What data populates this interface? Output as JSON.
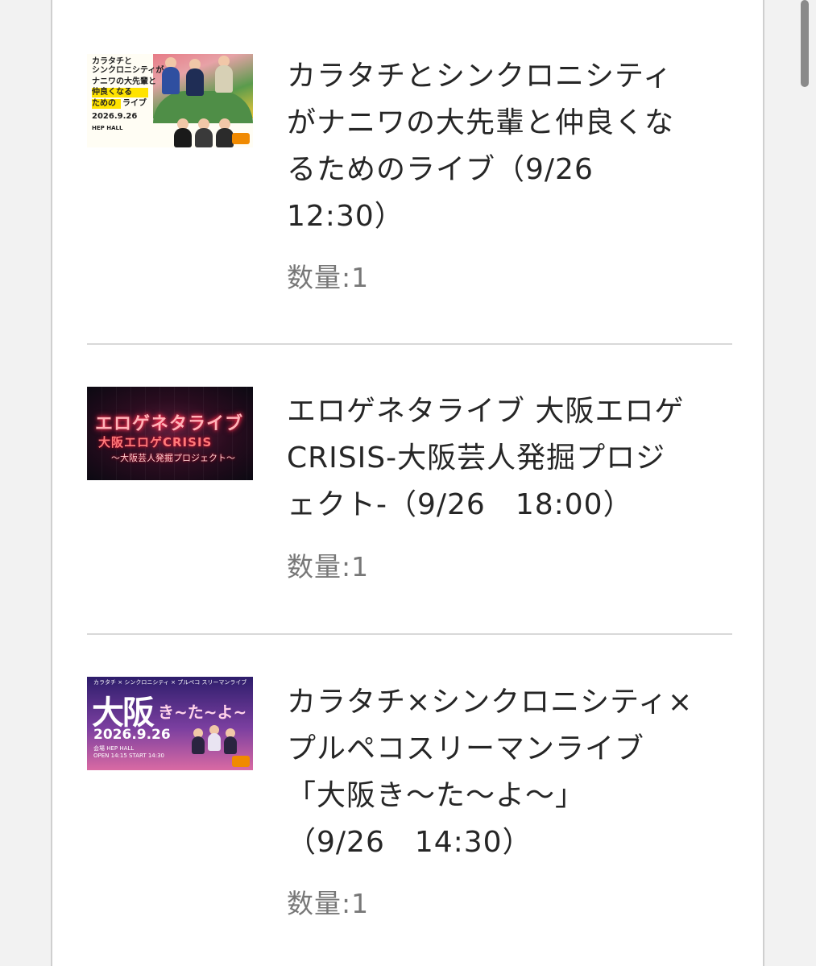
{
  "items": [
    {
      "title": "カラタチとシンクロニシティ\nがナニワの大先輩と仲良くな\nるためのライブ（9/26\n12:30）",
      "quantity": "数量:1",
      "thumb": {
        "line1": "カラタチと",
        "line2": "シンクロニシティが",
        "line3": "ナニワの大先輩と",
        "line4": "仲良くなる",
        "line5": "ための",
        "line6": "ライブ",
        "date": "2026.9.26",
        "venue": "HEP HALL"
      }
    },
    {
      "title": "エロゲネタライブ 大阪エロゲ\nCRISIS-大阪芸人発掘プロジ\nェクト-（9/26　18:00）",
      "quantity": "数量:1",
      "thumb": {
        "line1": "エロゲネタライブ",
        "line2": "大阪エロゲCRISIS",
        "line3": "〜大阪芸人発掘プロジェクト〜"
      }
    },
    {
      "title": "カラタチ×シンクロニシティ×\nプルペコスリーマンライブ\n「大阪き〜た〜よ〜」\n（9/26　14:30）",
      "quantity": "数量:1",
      "thumb": {
        "topline": "カラタチ × シンクロニシティ × プルペコ スリーマンライブ",
        "big": "大阪",
        "kana": "き~た~よ~",
        "date": "2026.9.26",
        "venue": "会場 HEP HALL",
        "times": "OPEN 14:15 START 14:30"
      }
    }
  ],
  "colors": {
    "title": "#262626",
    "quantity": "#777777",
    "separator": "#d8d8d8",
    "background": "#f2f2f2"
  }
}
